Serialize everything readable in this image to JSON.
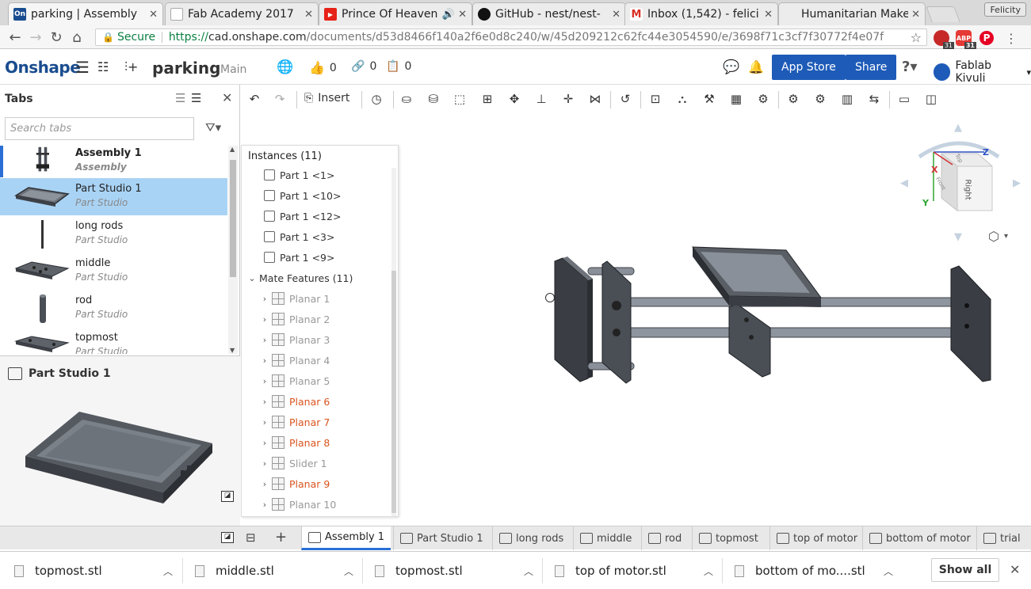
{
  "browser": {
    "tabs": [
      {
        "title": "parking | Assembly",
        "fav": "On",
        "fav_color": "#1a4d8f"
      },
      {
        "title": "Fab Academy 2017",
        "fav": "",
        "fav_color": "#ffffff"
      },
      {
        "title": "Prince Of Heaven",
        "fav": "▶",
        "fav_color": "#e62117"
      },
      {
        "title": "GitHub - nest/nest-",
        "fav": "",
        "fav_color": "#111111"
      },
      {
        "title": "Inbox (1,542) - felici",
        "fav": "M",
        "fav_color": "#d93025"
      },
      {
        "title": "Humanitarian Make",
        "fav": "",
        "fav_color": "#ffffff"
      }
    ],
    "profile": "Felicity",
    "secure": "Secure",
    "url_scheme": "https://",
    "url_host": "cad.onshape.com",
    "url_path": "/documents/d53d8466f140a2f6e0d8c240/w/45d209212c62fc44e3054590/e/3698f71c3cf7f30772f4e07f",
    "ext_badge_1": "31",
    "ext_badge_2": "31"
  },
  "header": {
    "logo": "Onshape",
    "doc_title": "parking",
    "branch": "Main",
    "likes": "0",
    "links": "0",
    "copies": "0",
    "app_store": "App Store",
    "share": "Share",
    "user": "Fablab Kivuli"
  },
  "toolbar": {
    "insert": "Insert"
  },
  "tabs_panel": {
    "title": "Tabs",
    "search_placeholder": "Search tabs",
    "items": [
      {
        "name": "Assembly 1",
        "type": "Assembly"
      },
      {
        "name": "Part Studio 1",
        "type": "Part Studio"
      },
      {
        "name": "long rods",
        "type": "Part Studio"
      },
      {
        "name": "middle",
        "type": "Part Studio"
      },
      {
        "name": "rod",
        "type": "Part Studio"
      },
      {
        "name": "topmost",
        "type": "Part Studio"
      }
    ],
    "preview_title": "Part Studio 1"
  },
  "instances": {
    "header": "Instances (11)",
    "parts": [
      "Part 1 <1>",
      "Part 1 <10>",
      "Part 1 <12>",
      "Part 1 <3>",
      "Part 1 <9>"
    ],
    "mate_header": "Mate Features (11)",
    "mates": [
      {
        "name": "Planar 1",
        "color": "#999999"
      },
      {
        "name": "Planar 2",
        "color": "#999999"
      },
      {
        "name": "Planar 3",
        "color": "#999999"
      },
      {
        "name": "Planar 4",
        "color": "#999999"
      },
      {
        "name": "Planar 5",
        "color": "#999999"
      },
      {
        "name": "Planar 6",
        "color": "#d9541e"
      },
      {
        "name": "Planar 7",
        "color": "#d9541e"
      },
      {
        "name": "Planar 8",
        "color": "#d9541e"
      },
      {
        "name": "Slider 1",
        "color": "#999999"
      },
      {
        "name": "Planar 9",
        "color": "#d9541e"
      },
      {
        "name": "Planar 10",
        "color": "#999999"
      }
    ]
  },
  "viewcube": {
    "face": "Right",
    "top": "Top",
    "front": "Front",
    "x": "X",
    "y": "Y",
    "z": "Z"
  },
  "bottom_tabs": [
    "Assembly 1",
    "Part Studio 1",
    "long rods",
    "middle",
    "rod",
    "topmost",
    "top of motor",
    "bottom of motor",
    "trial"
  ],
  "downloads": {
    "files": [
      "topmost.stl",
      "middle.stl",
      "topmost.stl",
      "top of motor.stl",
      "bottom of mo....stl"
    ],
    "show_all": "Show all"
  }
}
